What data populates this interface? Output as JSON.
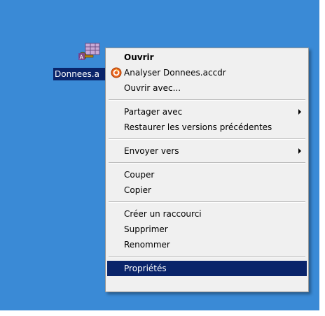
{
  "desktop": {
    "file": {
      "name_label": "Donnees.a",
      "icon": "access-database-file-icon"
    }
  },
  "context_menu": {
    "groups": [
      [
        {
          "label": "Ouvrir",
          "bold": true
        },
        {
          "label": "Analyser Donnees.accdr",
          "icon": "antivirus-scan-icon"
        },
        {
          "label": "Ouvrir avec..."
        }
      ],
      [
        {
          "label": "Partager avec",
          "submenu": true
        },
        {
          "label": "Restaurer les versions précédentes"
        }
      ],
      [
        {
          "label": "Envoyer vers",
          "submenu": true
        }
      ],
      [
        {
          "label": "Couper"
        },
        {
          "label": "Copier"
        }
      ],
      [
        {
          "label": "Créer un raccourci"
        },
        {
          "label": "Supprimer"
        },
        {
          "label": "Renommer"
        }
      ],
      [
        {
          "label": "Propriétés",
          "highlighted": true
        }
      ]
    ]
  },
  "colors": {
    "desktop_bg": "#3a8ad6",
    "selection_bg": "#0a246a",
    "menu_bg": "#f0f0f0"
  }
}
